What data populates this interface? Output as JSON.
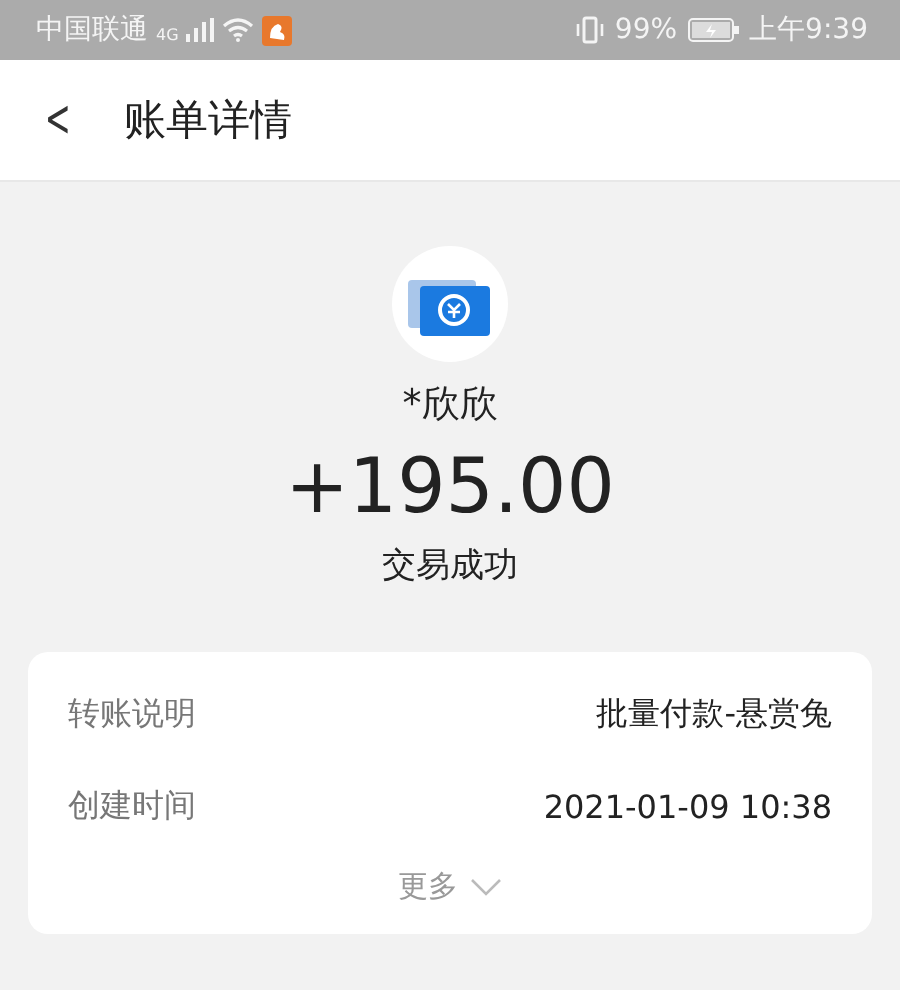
{
  "status_bar": {
    "carrier": "中国联通",
    "network": "4G",
    "battery": "99%",
    "time": "上午9:39"
  },
  "header": {
    "back": "<",
    "title": "账单详情"
  },
  "summary": {
    "name": "*欣欣",
    "amount": "+195.00",
    "status": "交易成功"
  },
  "details": [
    {
      "label": "转账说明",
      "value": "批量付款-悬赏兔"
    },
    {
      "label": "创建时间",
      "value": "2021-01-09 10:38"
    }
  ],
  "more": {
    "label": "更多",
    "expanded": false
  }
}
